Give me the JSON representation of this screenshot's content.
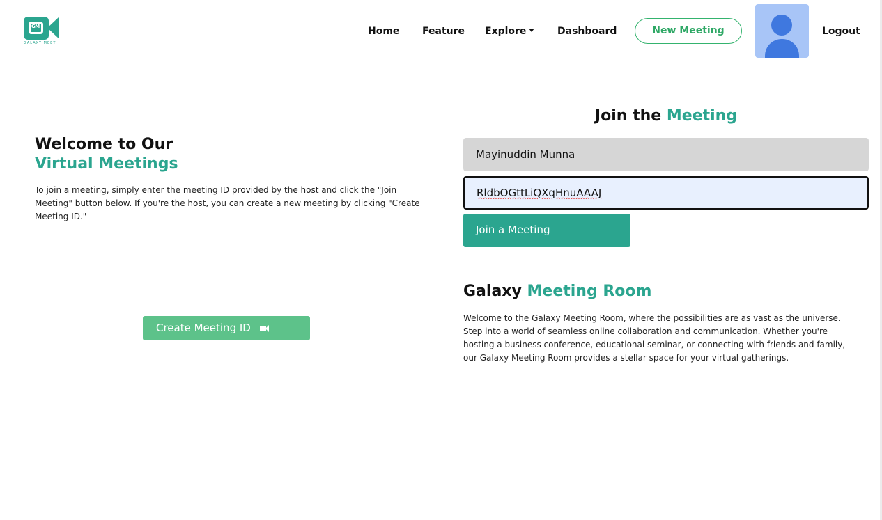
{
  "logo": {
    "caption": "GALAXY MEET",
    "mark": "GM"
  },
  "nav": {
    "home": "Home",
    "feature": "Feature",
    "explore": "Explore",
    "dashboard": "Dashboard",
    "new_meeting": "New Meeting",
    "logout": "Logout"
  },
  "welcome": {
    "title_line1": "Welcome to Our",
    "title_line2": "Virtual Meetings",
    "text": "To join a meeting, simply enter the meeting ID provided by the host and click the \"Join Meeting\" button below. If you're the host, you can create a new meeting by clicking \"Create Meeting ID.\"",
    "create_button": "Create Meeting ID"
  },
  "join": {
    "title_plain": "Join the",
    "title_accent": "Meeting",
    "name_value": "Mayinuddin Munna",
    "id_value": "RldbOGttLiQXqHnuAAAJ",
    "join_button": "Join a Meeting"
  },
  "room": {
    "title_plain": "Galaxy",
    "title_accent": "Meeting Room",
    "text": "Welcome to the Galaxy Meeting Room, where the possibilities are as vast as the universe. Step into a world of seamless online collaboration and communication. Whether you're hosting a business conference, educational seminar, or connecting with friends and family, our Galaxy Meeting Room provides a stellar space for your virtual gatherings."
  },
  "colors": {
    "accent": "#2ba58f",
    "create_button": "#5dc28a",
    "new_meeting_border": "#34b36e",
    "avatar_bg": "#a8c5f7",
    "avatar_fg": "#3f78df"
  },
  "icons": [
    "galaxy-meet-logo-icon",
    "caret-down-icon",
    "user-avatar-icon",
    "video-camera-icon"
  ]
}
